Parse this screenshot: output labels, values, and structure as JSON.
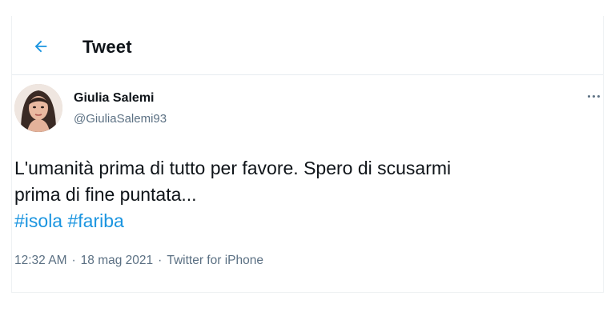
{
  "header": {
    "back_icon": "arrow-left-icon",
    "title": "Tweet"
  },
  "author": {
    "name": "Giulia Salemi",
    "handle": "@GiuliaSalemi93",
    "avatar_icon": "avatar"
  },
  "tweet": {
    "text_line1": "L'umanità prima di tutto per favore.  Spero di scusarmi",
    "text_line2": "prima di fine puntata...",
    "hashtags": [
      "#isola",
      "#fariba"
    ]
  },
  "meta": {
    "time": "12:32 AM",
    "date": "18 mag 2021",
    "source": "Twitter for iPhone",
    "separator": "·"
  },
  "colors": {
    "accent": "#1b95e0",
    "secondary_text": "#5b7083",
    "divider": "#e6ecf0"
  }
}
